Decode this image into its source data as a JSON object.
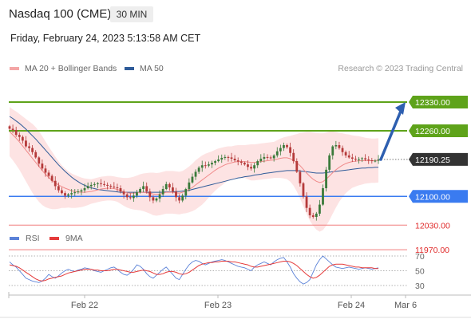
{
  "header": {
    "symbol": "Nasdaq 100 (CME)",
    "timeframe": "30 MIN",
    "datetime": "Friday, February 24, 2023 5:13:58 AM CET"
  },
  "legend": {
    "ma20_label": "MA 20 + Bollinger Bands",
    "ma50_label": "MA 50",
    "credit": "Research © 2023 Trading Central",
    "rsi_label": "RSI",
    "ma9_label": "9MA"
  },
  "colors": {
    "ma20": "#f08a8a",
    "ma50": "#2f5b99",
    "band_fill": "#fde3e3",
    "resistance": "#5ea31a",
    "pivot": "#3a7bf0",
    "support": "#f07c7c",
    "candle_up": "#3a7a3a",
    "candle_down": "#b53a3a",
    "arrow": "#2e5fb0",
    "last_price_box": "#333333",
    "rsi": "#5b82d8",
    "rsi_ma": "#e53b3b"
  },
  "chart_data": {
    "type": "candlestick",
    "x_labels": [
      "Feb 22",
      "Feb 23",
      "Feb 24",
      "Mar 6"
    ],
    "y_range": [
      11930,
      12390
    ],
    "grid": false,
    "legend_placement": "top-left",
    "last_price": "12190.25",
    "levels": [
      {
        "value": 12330,
        "label": "12330.00",
        "kind": "resistance"
      },
      {
        "value": 12260,
        "label": "12260.00",
        "kind": "resistance"
      },
      {
        "value": 12100,
        "label": "12100.00",
        "kind": "pivot"
      },
      {
        "value": 12030,
        "label": "12030.00",
        "kind": "support"
      },
      {
        "value": 11970,
        "label": "11970.00",
        "kind": "support"
      }
    ],
    "forecast": {
      "from": 12190,
      "to": 12330
    },
    "close": [
      12265,
      12262,
      12250,
      12245,
      12236,
      12222,
      12218,
      12208,
      12195,
      12180,
      12168,
      12158,
      12150,
      12138,
      12125,
      12115,
      12108,
      12102,
      12105,
      12108,
      12110,
      12112,
      12115,
      12120,
      12125,
      12128,
      12130,
      12132,
      12130,
      12128,
      12126,
      12124,
      12122,
      12120,
      12112,
      12105,
      12098,
      12096,
      12102,
      12110,
      12118,
      12125,
      12112,
      12098,
      12090,
      12095,
      12105,
      12118,
      12130,
      12122,
      12112,
      12098,
      12090,
      12102,
      12118,
      12134,
      12148,
      12160,
      12170,
      12176,
      12175,
      12178,
      12182,
      12186,
      12190,
      12194,
      12196,
      12195,
      12192,
      12188,
      12185,
      12182,
      12178,
      12172,
      12168,
      12176,
      12186,
      12192,
      12196,
      12195,
      12193,
      12200,
      12210,
      12218,
      12225,
      12220,
      12206,
      12186,
      12160,
      12132,
      12100,
      12072,
      12054,
      12050,
      12058,
      12080,
      12120,
      12165,
      12200,
      12222,
      12225,
      12218,
      12208,
      12200,
      12195,
      12192,
      12190,
      12191,
      12193,
      12190,
      12188,
      12186,
      12187,
      12190
    ],
    "ma20": [
      12258,
      12250,
      12242,
      12233,
      12223,
      12213,
      12203,
      12193,
      12183,
      12173,
      12163,
      12154,
      12146,
      12139,
      12133,
      12128,
      12124,
      12120,
      12117,
      12114,
      12112,
      12111,
      12110,
      12110,
      12111,
      12112,
      12114,
      12116,
      12118,
      12119,
      12120,
      12120,
      12119,
      12117,
      12114,
      12111,
      12109,
      12108,
      12108,
      12109,
      12110,
      12110,
      12109,
      12108,
      12106,
      12105,
      12106,
      12108,
      12110,
      12110,
      12110,
      12109,
      12108,
      12110,
      12113,
      12117,
      12122,
      12128,
      12134,
      12140,
      12146,
      12152,
      12158,
      12164,
      12169,
      12173,
      12177,
      12180,
      12182,
      12184,
      12185,
      12185,
      12185,
      12184,
      12183,
      12183,
      12184,
      12185,
      12186,
      12187,
      12188,
      12189,
      12191,
      12193,
      12194,
      12194,
      12192,
      12188,
      12182,
      12175,
      12166,
      12157,
      12149,
      12142,
      12137,
      12134,
      12136,
      12142,
      12150,
      12158,
      12165,
      12171,
      12176,
      12180,
      12183,
      12185,
      12186,
      12187,
      12187,
      12187,
      12187,
      12187,
      12187,
      12188
    ],
    "ma50": [
      12295,
      12290,
      12284,
      12278,
      12271,
      12264,
      12256,
      12248,
      12240,
      12231,
      12222,
      12213,
      12204,
      12195,
      12186,
      12177,
      12169,
      12161,
      12154,
      12147,
      12141,
      12136,
      12131,
      12127,
      12124,
      12121,
      12119,
      12117,
      12116,
      12115,
      12114,
      12113,
      12112,
      12111,
      12110,
      12110,
      12110,
      12110,
      12110,
      12110,
      12110,
      12110,
      12110,
      12110,
      12110,
      12110,
      12110,
      12110,
      12111,
      12111,
      12111,
      12112,
      12112,
      12113,
      12114,
      12115,
      12117,
      12119,
      12121,
      12123,
      12125,
      12127,
      12129,
      12131,
      12133,
      12135,
      12137,
      12139,
      12141,
      12143,
      12145,
      12146,
      12148,
      12149,
      12150,
      12152,
      12153,
      12154,
      12156,
      12157,
      12158,
      12159,
      12160,
      12161,
      12162,
      12163,
      12163,
      12163,
      12163,
      12162,
      12161,
      12160,
      12159,
      12158,
      12157,
      12157,
      12157,
      12158,
      12159,
      12160,
      12161,
      12162,
      12163,
      12164,
      12165,
      12166,
      12167,
      12168,
      12169,
      12169,
      12170,
      12170,
      12171,
      12171
    ],
    "band_width": [
      60,
      62,
      65,
      68,
      72,
      76,
      80,
      84,
      86,
      86,
      84,
      80,
      75,
      70,
      64,
      58,
      52,
      48,
      44,
      42,
      40,
      38,
      36,
      34,
      32,
      30,
      30,
      30,
      30,
      30,
      30,
      30,
      30,
      30,
      32,
      34,
      36,
      38,
      40,
      42,
      44,
      46,
      48,
      50,
      52,
      52,
      52,
      52,
      52,
      52,
      52,
      52,
      52,
      52,
      54,
      56,
      58,
      60,
      60,
      60,
      58,
      55,
      52,
      50,
      48,
      46,
      44,
      42,
      40,
      40,
      40,
      40,
      40,
      42,
      44,
      44,
      44,
      44,
      44,
      44,
      44,
      44,
      46,
      48,
      50,
      52,
      56,
      62,
      70,
      80,
      90,
      100,
      108,
      114,
      118,
      120,
      118,
      114,
      108,
      100,
      92,
      84,
      78,
      72,
      68,
      64,
      62,
      60,
      58,
      56,
      55,
      54,
      54,
      54
    ],
    "rsi": [
      62,
      58,
      55,
      50,
      45,
      40,
      38,
      36,
      35,
      34,
      36,
      40,
      45,
      42,
      40,
      43,
      47,
      50,
      52,
      50,
      49,
      51,
      52,
      54,
      53,
      52,
      50,
      49,
      48,
      50,
      52,
      54,
      55,
      52,
      48,
      45,
      44,
      47,
      52,
      58,
      56,
      52,
      46,
      42,
      40,
      44,
      48,
      52,
      55,
      50,
      45,
      40,
      38,
      45,
      52,
      58,
      62,
      64,
      63,
      60,
      58,
      60,
      62,
      63,
      64,
      65,
      64,
      62,
      60,
      58,
      56,
      55,
      54,
      52,
      50,
      55,
      58,
      60,
      62,
      60,
      58,
      62,
      65,
      67,
      68,
      62,
      55,
      46,
      40,
      35,
      32,
      34,
      38,
      48,
      58,
      65,
      70,
      66,
      62,
      58,
      55,
      54,
      53,
      54,
      55,
      54,
      53,
      52,
      53,
      54,
      53,
      52,
      53,
      54
    ],
    "rsi_ma": [
      58,
      57,
      56,
      54,
      51,
      48,
      45,
      42,
      39,
      37,
      36,
      37,
      39,
      40,
      41,
      42,
      43,
      45,
      47,
      48,
      49,
      50,
      51,
      52,
      52,
      52,
      51,
      51,
      50,
      50,
      50,
      51,
      52,
      52,
      51,
      50,
      49,
      48,
      48,
      49,
      50,
      51,
      50,
      49,
      47,
      45,
      45,
      46,
      48,
      49,
      49,
      48,
      46,
      45,
      46,
      48,
      51,
      54,
      57,
      59,
      60,
      61,
      61,
      62,
      62,
      63,
      63,
      63,
      62,
      62,
      61,
      60,
      59,
      58,
      56,
      55,
      55,
      56,
      57,
      58,
      59,
      60,
      61,
      62,
      63,
      63,
      62,
      60,
      57,
      53,
      49,
      45,
      42,
      40,
      41,
      44,
      48,
      52,
      56,
      58,
      59,
      59,
      59,
      58,
      57,
      56,
      55,
      55,
      54,
      54,
      54,
      54,
      53,
      53
    ],
    "rsi_ticks": [
      "70",
      "50",
      "30"
    ]
  }
}
